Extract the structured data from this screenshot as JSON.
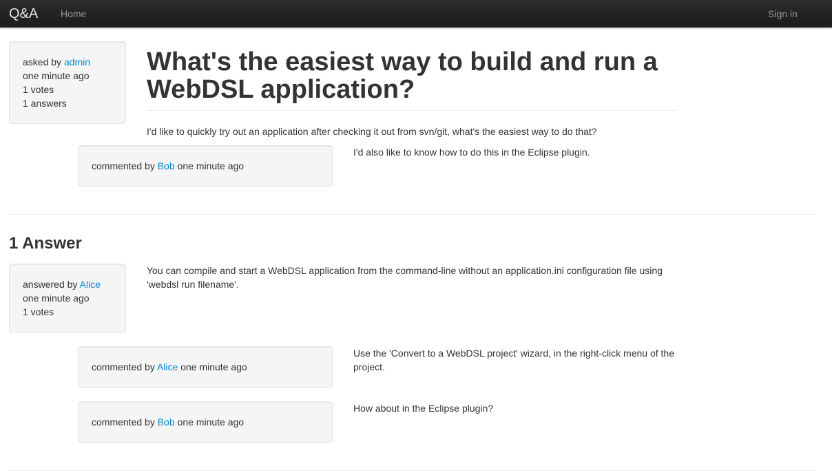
{
  "navbar": {
    "brand": "Q&A",
    "home": "Home",
    "sign_in": "Sign in"
  },
  "question": {
    "title": "What's the easiest way to build and run a WebDSL application?",
    "asked_prefix": "asked by",
    "author": "admin",
    "time": "one minute ago",
    "votes": "1 votes",
    "answers": "1 answers",
    "body": "I'd like to quickly try out an application after checking it out from svn/git, what's the easiest way to do that?",
    "comments": [
      {
        "prefix": "commented by",
        "author": "Bob",
        "time": "one minute ago",
        "text": "I'd also like to know how to do this in the Eclipse plugin."
      }
    ]
  },
  "answers_heading": "1 Answer",
  "answers": [
    {
      "prefix": "answered by",
      "author": "Alice",
      "time": "one minute ago",
      "votes": "1 votes",
      "body": "You can compile and start a WebDSL application from the command-line without an application.ini configuration file using 'webdsl run filename'.",
      "comments": [
        {
          "prefix": "commented by",
          "author": "Alice",
          "time": "one minute ago",
          "text": "Use the 'Convert to a WebDSL project' wizard, in the right-click menu of the project."
        },
        {
          "prefix": "commented by",
          "author": "Bob",
          "time": "one minute ago",
          "text": "How about in the Eclipse plugin?"
        }
      ]
    }
  ]
}
